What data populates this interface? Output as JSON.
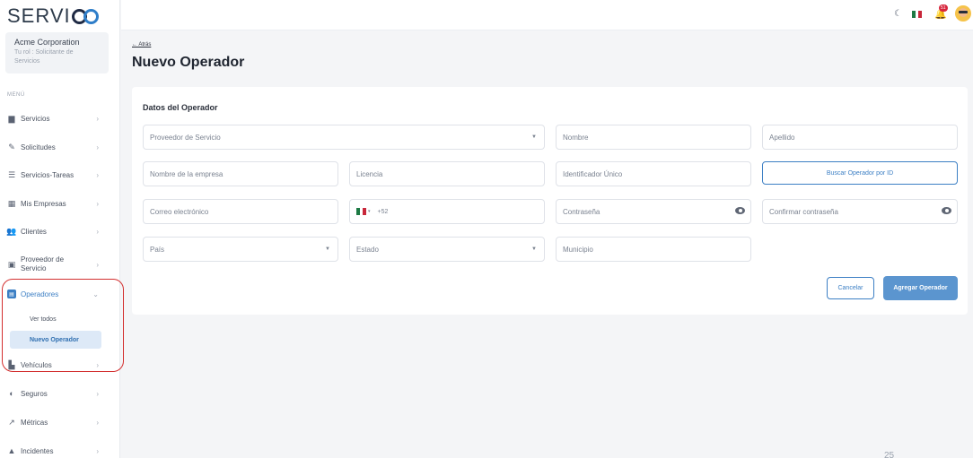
{
  "brand": {
    "logo_text": "SERVI",
    "logo_suffix": "GO"
  },
  "org": {
    "name": "Acme Corporation",
    "role": "Tu rol : Solicitante de Servicios"
  },
  "menu": {
    "label": "MENÚ",
    "items": [
      {
        "label": "Servicios",
        "icon": "briefcase-icon"
      },
      {
        "label": "Solicitudes",
        "icon": "request-icon"
      },
      {
        "label": "Servicios-Tareas",
        "icon": "tasks-icon"
      },
      {
        "label": "Mis Empresas",
        "icon": "building-icon"
      },
      {
        "label": "Clientes",
        "icon": "users-icon"
      },
      {
        "label": "Proveedor de Servicio",
        "icon": "provider-icon"
      },
      {
        "label": "Operadores",
        "icon": "id-card-icon"
      },
      {
        "label": "Vehículos",
        "icon": "truck-icon"
      },
      {
        "label": "Seguros",
        "icon": "shield-icon"
      },
      {
        "label": "Métricas",
        "icon": "chart-icon"
      },
      {
        "label": "Incidentes",
        "icon": "warning-icon"
      }
    ],
    "sub_items": [
      {
        "label": "Ver todos"
      },
      {
        "label": "Nuevo Operador"
      }
    ]
  },
  "topbar": {
    "notification_count": "51"
  },
  "header": {
    "back_label": "← Atrás",
    "title": "Nuevo Operador"
  },
  "form": {
    "section_title": "Datos del Operador",
    "provider_placeholder": "Proveedor de Servicio",
    "first_name_placeholder": "Nombre",
    "last_name_placeholder": "Apellido",
    "company_placeholder": "Nombre de la empresa",
    "license_placeholder": "Licencia",
    "unique_id_placeholder": "Identificador Único",
    "search_id_label": "Buscar Operador por ID",
    "email_placeholder": "Correo electrónico",
    "phone_code": "+52",
    "password_placeholder": "Contraseña",
    "confirm_password_placeholder": "Confirmar contraseña",
    "country_placeholder": "País",
    "state_placeholder": "Estado",
    "municipality_placeholder": "Municipio",
    "cancel_label": "Cancelar",
    "submit_label": "Agregar Operador"
  },
  "colors": {
    "accent": "#3c7fc4",
    "primary_button": "#5b95cf",
    "highlight": "#d32f2f"
  },
  "footer": {
    "page_number": "25"
  }
}
